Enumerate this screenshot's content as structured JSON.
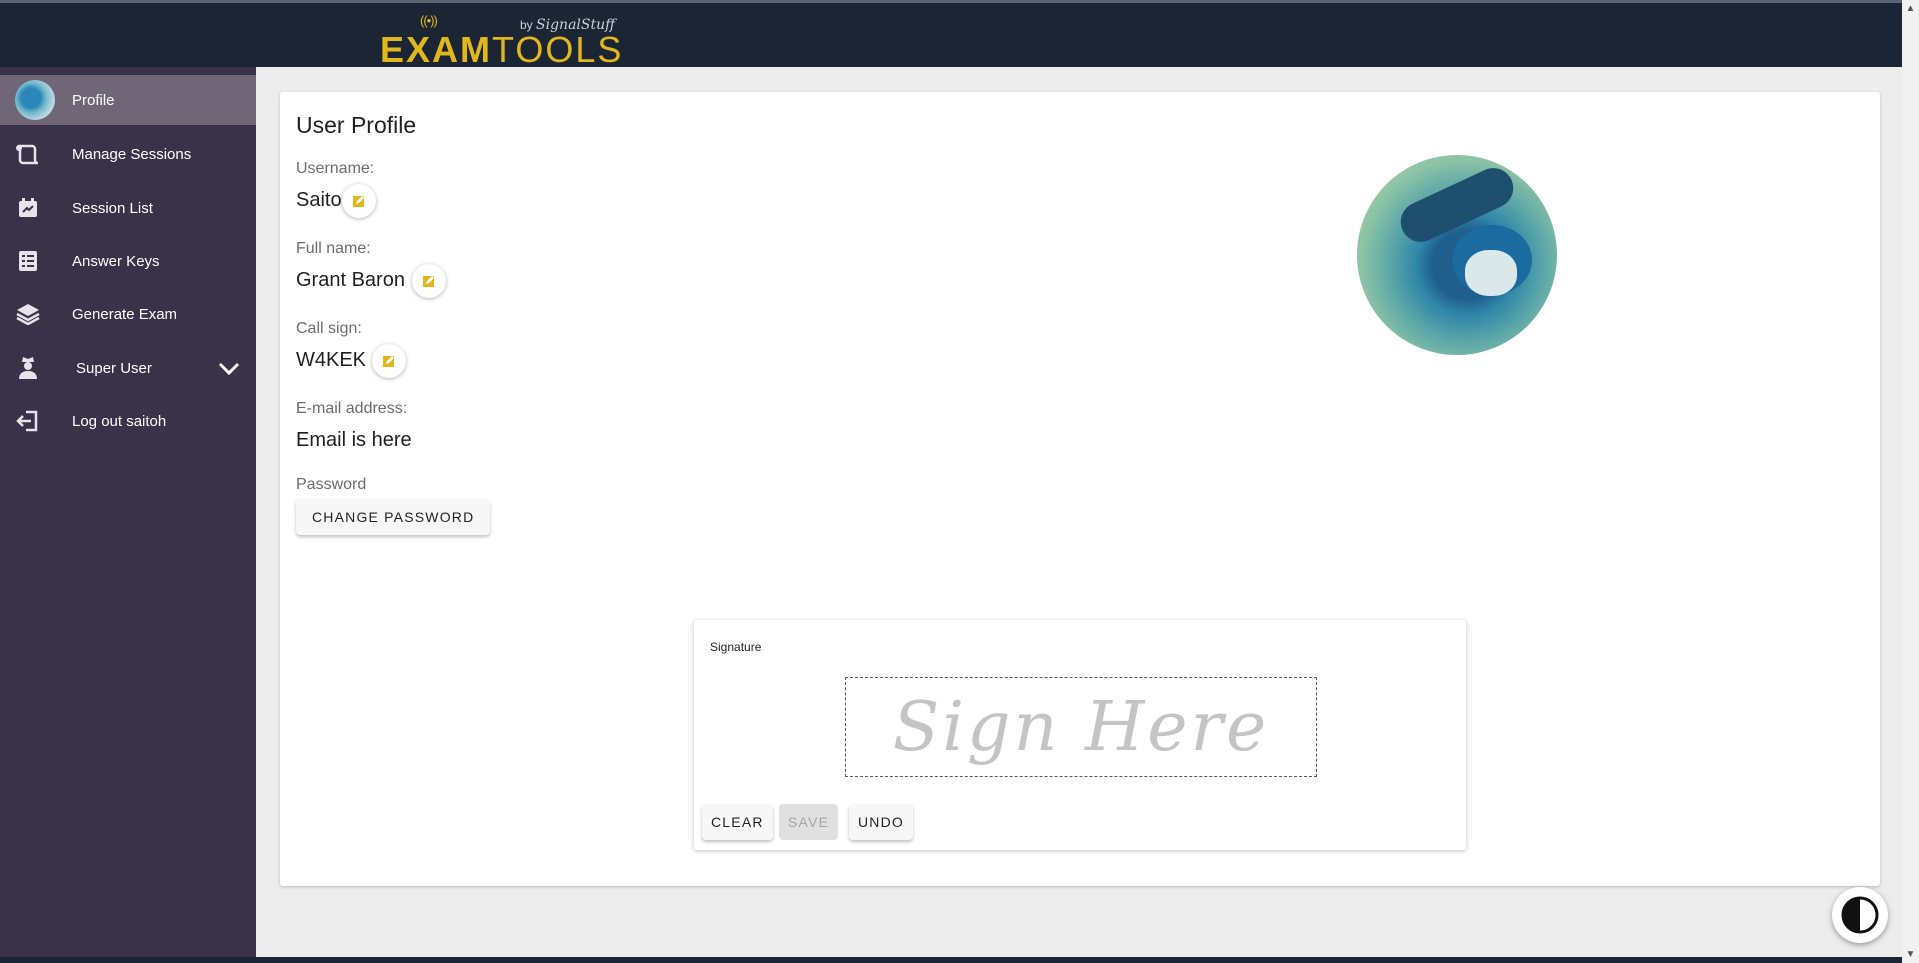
{
  "brand": {
    "exam": "EXAM",
    "tools": "TOOLS",
    "by": "by",
    "company": "SignalStuff"
  },
  "sidebar": {
    "items": [
      {
        "label": "Profile",
        "icon": "avatar"
      },
      {
        "label": "Manage Sessions",
        "icon": "scroll-icon"
      },
      {
        "label": "Session List",
        "icon": "calendar-icon"
      },
      {
        "label": "Answer Keys",
        "icon": "list-icon"
      },
      {
        "label": "Generate Exam",
        "icon": "layers-icon"
      },
      {
        "label": "Super User",
        "icon": "spy-icon"
      },
      {
        "label": "Log out saitoh",
        "icon": "logout-icon"
      }
    ]
  },
  "profile": {
    "title": "User Profile",
    "username_label": "Username:",
    "username": "Saito",
    "fullname_label": "Full name:",
    "fullname": "Grant Baron",
    "callsign_label": "Call sign:",
    "callsign": "W4KEK",
    "email_label": "E-mail address:",
    "email": "Email is here",
    "password_label": "Password",
    "change_password": "CHANGE PASSWORD"
  },
  "signature": {
    "title": "Signature",
    "placeholder": "Sign Here",
    "clear": "CLEAR",
    "save": "SAVE",
    "undo": "UNDO"
  },
  "colors": {
    "brand": "#e0b81e",
    "sidebar": "#3a3248",
    "header": "#1c2533",
    "edit_icon": "#e0b81e"
  }
}
